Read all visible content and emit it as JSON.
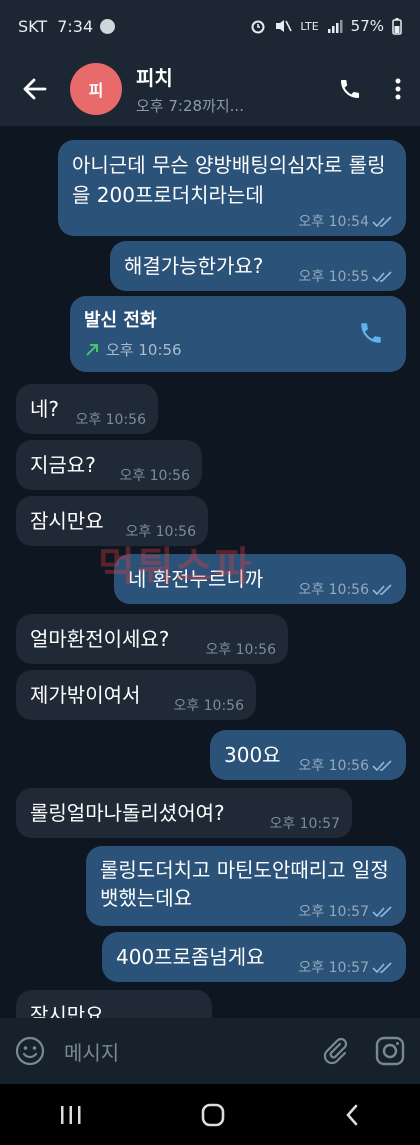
{
  "status": {
    "carrier": "SKT",
    "time": "7:34",
    "net": "LTE",
    "battery": "57%"
  },
  "header": {
    "avatar_text": "피",
    "name": "피치",
    "subtitle": "오후 7:28까지..."
  },
  "messages": [
    {
      "text": "아니근데 무슨 양방배팅의심자로 롤링을 200프로더치라는데",
      "time": "오후 10:54"
    },
    {
      "text": "해결가능한가요?",
      "time": "오후 10:55"
    },
    {
      "call_title": "발신 전화",
      "time": "오후 10:56"
    },
    {
      "text": "네?",
      "time": "오후 10:56"
    },
    {
      "text": "지금요?",
      "time": "오후 10:56"
    },
    {
      "text": "잠시만요",
      "time": "오후 10:56"
    },
    {
      "text": "네 환전누르니까",
      "time": "오후 10:56"
    },
    {
      "text": "얼마환전이세요?",
      "time": "오후 10:56"
    },
    {
      "text": "제가밖이여서",
      "time": "오후 10:56"
    },
    {
      "text": "300요",
      "time": "오후 10:56"
    },
    {
      "text": "롤링얼마나돌리셨어여?",
      "time": "오후 10:57"
    },
    {
      "text": "롤링도더치고 마틴도안때리고 일정뱃했는데요",
      "time": "오후 10:57"
    },
    {
      "text": "400프로좀넘게요",
      "time": "오후 10:57"
    },
    {
      "text": "잠시만요"
    }
  ],
  "watermark": "먹튀스파",
  "input": {
    "placeholder": "메시지"
  }
}
